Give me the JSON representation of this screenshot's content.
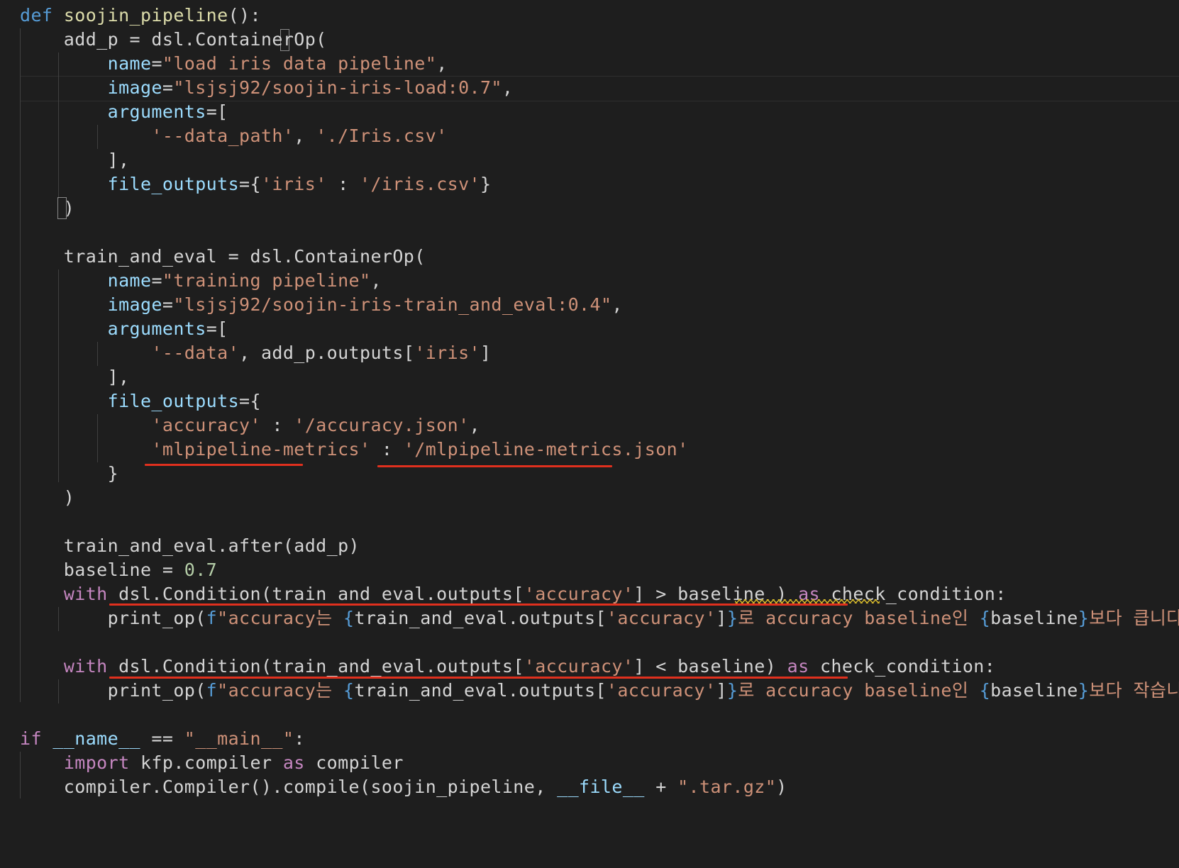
{
  "editor": {
    "language": "python",
    "theme_colors": {
      "background": "#1e1e1e",
      "keyword": "#569cd6",
      "control_keyword": "#c586c0",
      "function": "#dcdcaa",
      "variable": "#9cdcfe",
      "string": "#ce9178",
      "number": "#b5cea8",
      "annotation_underline": "#e0301e",
      "warning_squiggle": "#d7ba2b"
    },
    "lines": [
      [
        {
          "t": "def",
          "c": "kw-blue"
        },
        {
          "t": " "
        },
        {
          "t": "soojin_pipeline",
          "c": "fn"
        },
        {
          "t": "():"
        }
      ],
      [
        {
          "t": "    add_p = dsl.ContainerOp("
        }
      ],
      [
        {
          "t": "        "
        },
        {
          "t": "name",
          "c": "var"
        },
        {
          "t": "="
        },
        {
          "t": "\"load iris data pipeline\"",
          "c": "str"
        },
        {
          "t": ","
        }
      ],
      [
        {
          "t": "        "
        },
        {
          "t": "image",
          "c": "var"
        },
        {
          "t": "="
        },
        {
          "t": "\"lsjsj92/soojin-iris-load:0.7\"",
          "c": "str"
        },
        {
          "t": ","
        }
      ],
      [
        {
          "t": "        "
        },
        {
          "t": "arguments",
          "c": "var"
        },
        {
          "t": "=["
        }
      ],
      [
        {
          "t": "            "
        },
        {
          "t": "'--data_path'",
          "c": "str"
        },
        {
          "t": ", "
        },
        {
          "t": "'./Iris.csv'",
          "c": "str"
        }
      ],
      [
        {
          "t": "        ],"
        }
      ],
      [
        {
          "t": "        "
        },
        {
          "t": "file_outputs",
          "c": "var"
        },
        {
          "t": "={"
        },
        {
          "t": "'iris'",
          "c": "str"
        },
        {
          "t": " : "
        },
        {
          "t": "'/iris.csv'",
          "c": "str"
        },
        {
          "t": "}"
        }
      ],
      [
        {
          "t": "    )"
        }
      ],
      [],
      [
        {
          "t": "    train_and_eval = dsl.ContainerOp("
        }
      ],
      [
        {
          "t": "        "
        },
        {
          "t": "name",
          "c": "var"
        },
        {
          "t": "="
        },
        {
          "t": "\"training pipeline\"",
          "c": "str"
        },
        {
          "t": ","
        }
      ],
      [
        {
          "t": "        "
        },
        {
          "t": "image",
          "c": "var"
        },
        {
          "t": "="
        },
        {
          "t": "\"lsjsj92/soojin-iris-train_and_eval:0.4\"",
          "c": "str"
        },
        {
          "t": ","
        }
      ],
      [
        {
          "t": "        "
        },
        {
          "t": "arguments",
          "c": "var"
        },
        {
          "t": "=["
        }
      ],
      [
        {
          "t": "            "
        },
        {
          "t": "'--data'",
          "c": "str"
        },
        {
          "t": ", add_p.outputs["
        },
        {
          "t": "'iris'",
          "c": "str"
        },
        {
          "t": "]"
        }
      ],
      [
        {
          "t": "        ],"
        }
      ],
      [
        {
          "t": "        "
        },
        {
          "t": "file_outputs",
          "c": "var"
        },
        {
          "t": "={"
        }
      ],
      [
        {
          "t": "            "
        },
        {
          "t": "'accuracy'",
          "c": "str"
        },
        {
          "t": " : "
        },
        {
          "t": "'/accuracy.json'",
          "c": "str"
        },
        {
          "t": ","
        }
      ],
      [
        {
          "t": "            "
        },
        {
          "t": "'mlpipeline-metrics'",
          "c": "str"
        },
        {
          "t": " : "
        },
        {
          "t": "'/mlpipeline-metrics.json'",
          "c": "str"
        }
      ],
      [
        {
          "t": "        }"
        }
      ],
      [
        {
          "t": "    )"
        }
      ],
      [],
      [
        {
          "t": "    train_and_eval.after(add_p)"
        }
      ],
      [
        {
          "t": "    baseline = "
        },
        {
          "t": "0.7",
          "c": "num"
        }
      ],
      [
        {
          "t": "    "
        },
        {
          "t": "with",
          "c": "kw-purple"
        },
        {
          "t": " dsl.Condition(train_and_eval.outputs["
        },
        {
          "t": "'accuracy'",
          "c": "str"
        },
        {
          "t": "] > baseline ) "
        },
        {
          "t": "as",
          "c": "kw-purple"
        },
        {
          "t": " check_condition:"
        }
      ],
      [
        {
          "t": "        print_op("
        },
        {
          "t": "f",
          "c": "kw-blue"
        },
        {
          "t": "\"accuracy는 ",
          "c": "str"
        },
        {
          "t": "{",
          "c": "kw-blue"
        },
        {
          "t": "train_and_eval.outputs["
        },
        {
          "t": "'accuracy'",
          "c": "str"
        },
        {
          "t": "]"
        },
        {
          "t": "}",
          "c": "kw-blue"
        },
        {
          "t": "로 accuracy baseline인 ",
          "c": "str"
        },
        {
          "t": "{",
          "c": "kw-blue"
        },
        {
          "t": "baseline"
        },
        {
          "t": "}",
          "c": "kw-blue"
        },
        {
          "t": "보다 큽니다!\"",
          "c": "str"
        },
        {
          "t": ")"
        }
      ],
      [],
      [
        {
          "t": "    "
        },
        {
          "t": "with",
          "c": "kw-purple"
        },
        {
          "t": " dsl.Condition(train_and_eval.outputs["
        },
        {
          "t": "'accuracy'",
          "c": "str"
        },
        {
          "t": "] < baseline) "
        },
        {
          "t": "as",
          "c": "kw-purple"
        },
        {
          "t": " check_condition:"
        }
      ],
      [
        {
          "t": "        print_op("
        },
        {
          "t": "f",
          "c": "kw-blue"
        },
        {
          "t": "\"accuracy는 ",
          "c": "str"
        },
        {
          "t": "{",
          "c": "kw-blue"
        },
        {
          "t": "train_and_eval.outputs["
        },
        {
          "t": "'accuracy'",
          "c": "str"
        },
        {
          "t": "]"
        },
        {
          "t": "}",
          "c": "kw-blue"
        },
        {
          "t": "로 accuracy baseline인 ",
          "c": "str"
        },
        {
          "t": "{",
          "c": "kw-blue"
        },
        {
          "t": "baseline"
        },
        {
          "t": "}",
          "c": "kw-blue"
        },
        {
          "t": "보다 작습니다.\"",
          "c": "str"
        },
        {
          "t": ")"
        }
      ],
      [],
      [
        {
          "t": "if",
          "c": "kw-purple"
        },
        {
          "t": " "
        },
        {
          "t": "__name__",
          "c": "var"
        },
        {
          "t": " == "
        },
        {
          "t": "\"__main__\"",
          "c": "str"
        },
        {
          "t": ":"
        }
      ],
      [
        {
          "t": "    "
        },
        {
          "t": "import",
          "c": "kw-purple"
        },
        {
          "t": " kfp.compiler "
        },
        {
          "t": "as",
          "c": "kw-purple"
        },
        {
          "t": " compiler"
        }
      ],
      [
        {
          "t": "    compiler.Compiler().compile(soojin_pipeline, "
        },
        {
          "t": "__file__",
          "c": "var"
        },
        {
          "t": " + "
        },
        {
          "t": "\".tar.gz\"",
          "c": "str"
        },
        {
          "t": ")"
        }
      ]
    ]
  }
}
